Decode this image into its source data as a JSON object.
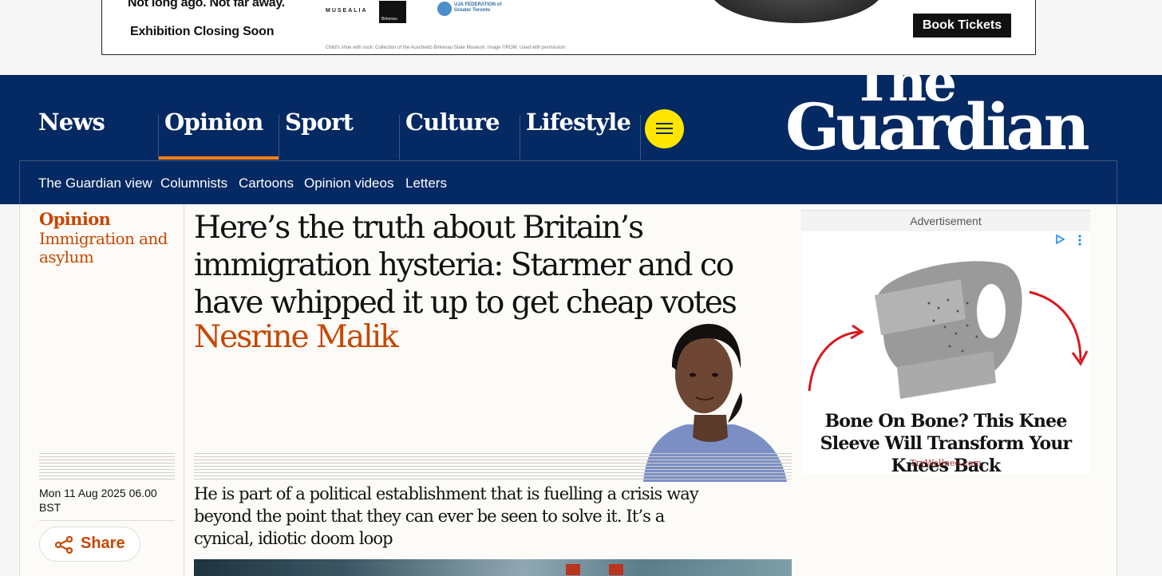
{
  "banner_ad": {
    "tagline": "Not long ago. Not far away.",
    "status": "Exhibition Closing Soon",
    "partner_1": "MUSEALIA",
    "partner_2": "Birkenau",
    "partner_3": "UJA FEDERATION of Greater Toronto",
    "credit": "Child's shoe with sock. Collection of the Auschwitz-Birkenau State Museum. Image ©ROM. Used with permission.",
    "cta": "Book Tickets"
  },
  "header": {
    "pillars": [
      {
        "label": "News",
        "active": false
      },
      {
        "label": "Opinion",
        "active": true
      },
      {
        "label": "Sport",
        "active": false
      },
      {
        "label": "Culture",
        "active": false
      },
      {
        "label": "Lifestyle",
        "active": false
      }
    ],
    "menu_icon": "hamburger-menu-icon",
    "logo_line1": "The",
    "logo_line2": "Guardian",
    "subnav": [
      "The Guardian view",
      "Columnists",
      "Cartoons",
      "Opinion videos",
      "Letters"
    ]
  },
  "article": {
    "section": "Opinion",
    "series": "Immigration and asylum",
    "headline": "Here’s the truth about Britain’s immigration hysteria: Starmer and co have whipped it up to get cheap votes",
    "byline": "Nesrine Malik",
    "dateline": "Mon 11 Aug 2025 06.00 BST",
    "share_label": "Share",
    "share_icon": "share-icon",
    "standfirst": "He is part of a political establishment that is fuelling a crisis way beyond the point that they can ever be seen to solve it. It’s a cynical, idiotic doom loop"
  },
  "sidebar_ad": {
    "label": "Advertisement",
    "title": "Bone On Bone? This Knee Sleeve Will Transform Your Knees Back",
    "source": "TryWellnee.com",
    "adchoices_icon": "adchoices-icon"
  },
  "colors": {
    "brand_blue": "#052962",
    "opinion_orange": "#c74600",
    "menu_yellow": "#ffe500",
    "active_underline": "#ff7f0f"
  }
}
